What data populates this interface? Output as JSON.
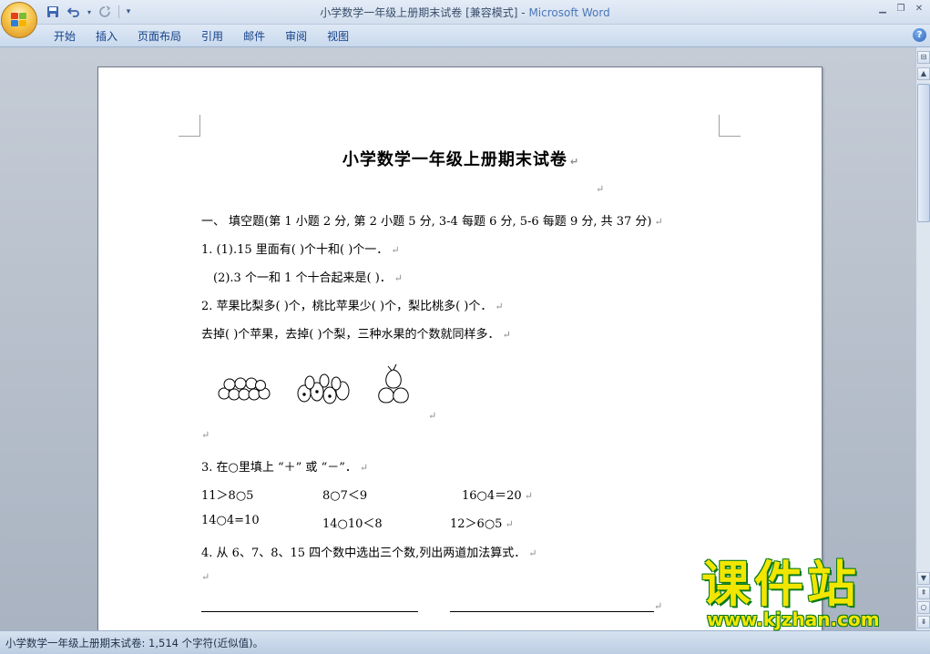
{
  "window": {
    "title_doc": "小学数学一年级上册期末试卷 [兼容模式]",
    "title_sep": " - ",
    "title_app": "Microsoft Word"
  },
  "qat": {
    "save_icon": "save-icon",
    "undo_icon": "undo-icon",
    "redo_icon": "redo-icon",
    "customize_icon": "dropdown-icon"
  },
  "ribbon": {
    "tabs": [
      "开始",
      "插入",
      "页面布局",
      "引用",
      "邮件",
      "审阅",
      "视图"
    ]
  },
  "document": {
    "title": "小学数学一年级上册期末试卷",
    "section1_heading": "一、 填空题(第 1 小题 2 分, 第 2 小题 5 分, 3-4 每题 6 分, 5-6 每题 9 分, 共 37 分)",
    "q1_1": "1. (1).15 里面有(    )个十和(    )个一．",
    "q1_2": "(2).3 个一和 1 个十合起来是(    )．",
    "q2_1": "2. 苹果比梨多(     )个，桃比苹果少(     )个，梨比桃多(     )个．",
    "q2_2": "去掉(     )个苹果，去掉(     )个梨，三种水果的个数就同样多．",
    "q3_heading": "3. 在○里填上 “＋” 或 “－”．",
    "q3_rows": [
      [
        "11＞8○5",
        "8○7＜9",
        "16○4＝20"
      ],
      [
        "14○4=10",
        "14○10＜8",
        "12＞6○5"
      ]
    ],
    "q4_heading": "4. 从 6、7、8、15 四个数中选出三个数,列出两道加法算式．",
    "para_mark": "↵"
  },
  "statusbar": {
    "text": "小学数学一年级上册期末试卷: 1,514 个字符(近似值)。"
  },
  "watermark": {
    "main": "课件站",
    "url": "www.kjzhan.com"
  },
  "colors": {
    "accent": "#15428b",
    "watermark": "#f2e600",
    "watermark_outline": "#0a7a1a"
  }
}
